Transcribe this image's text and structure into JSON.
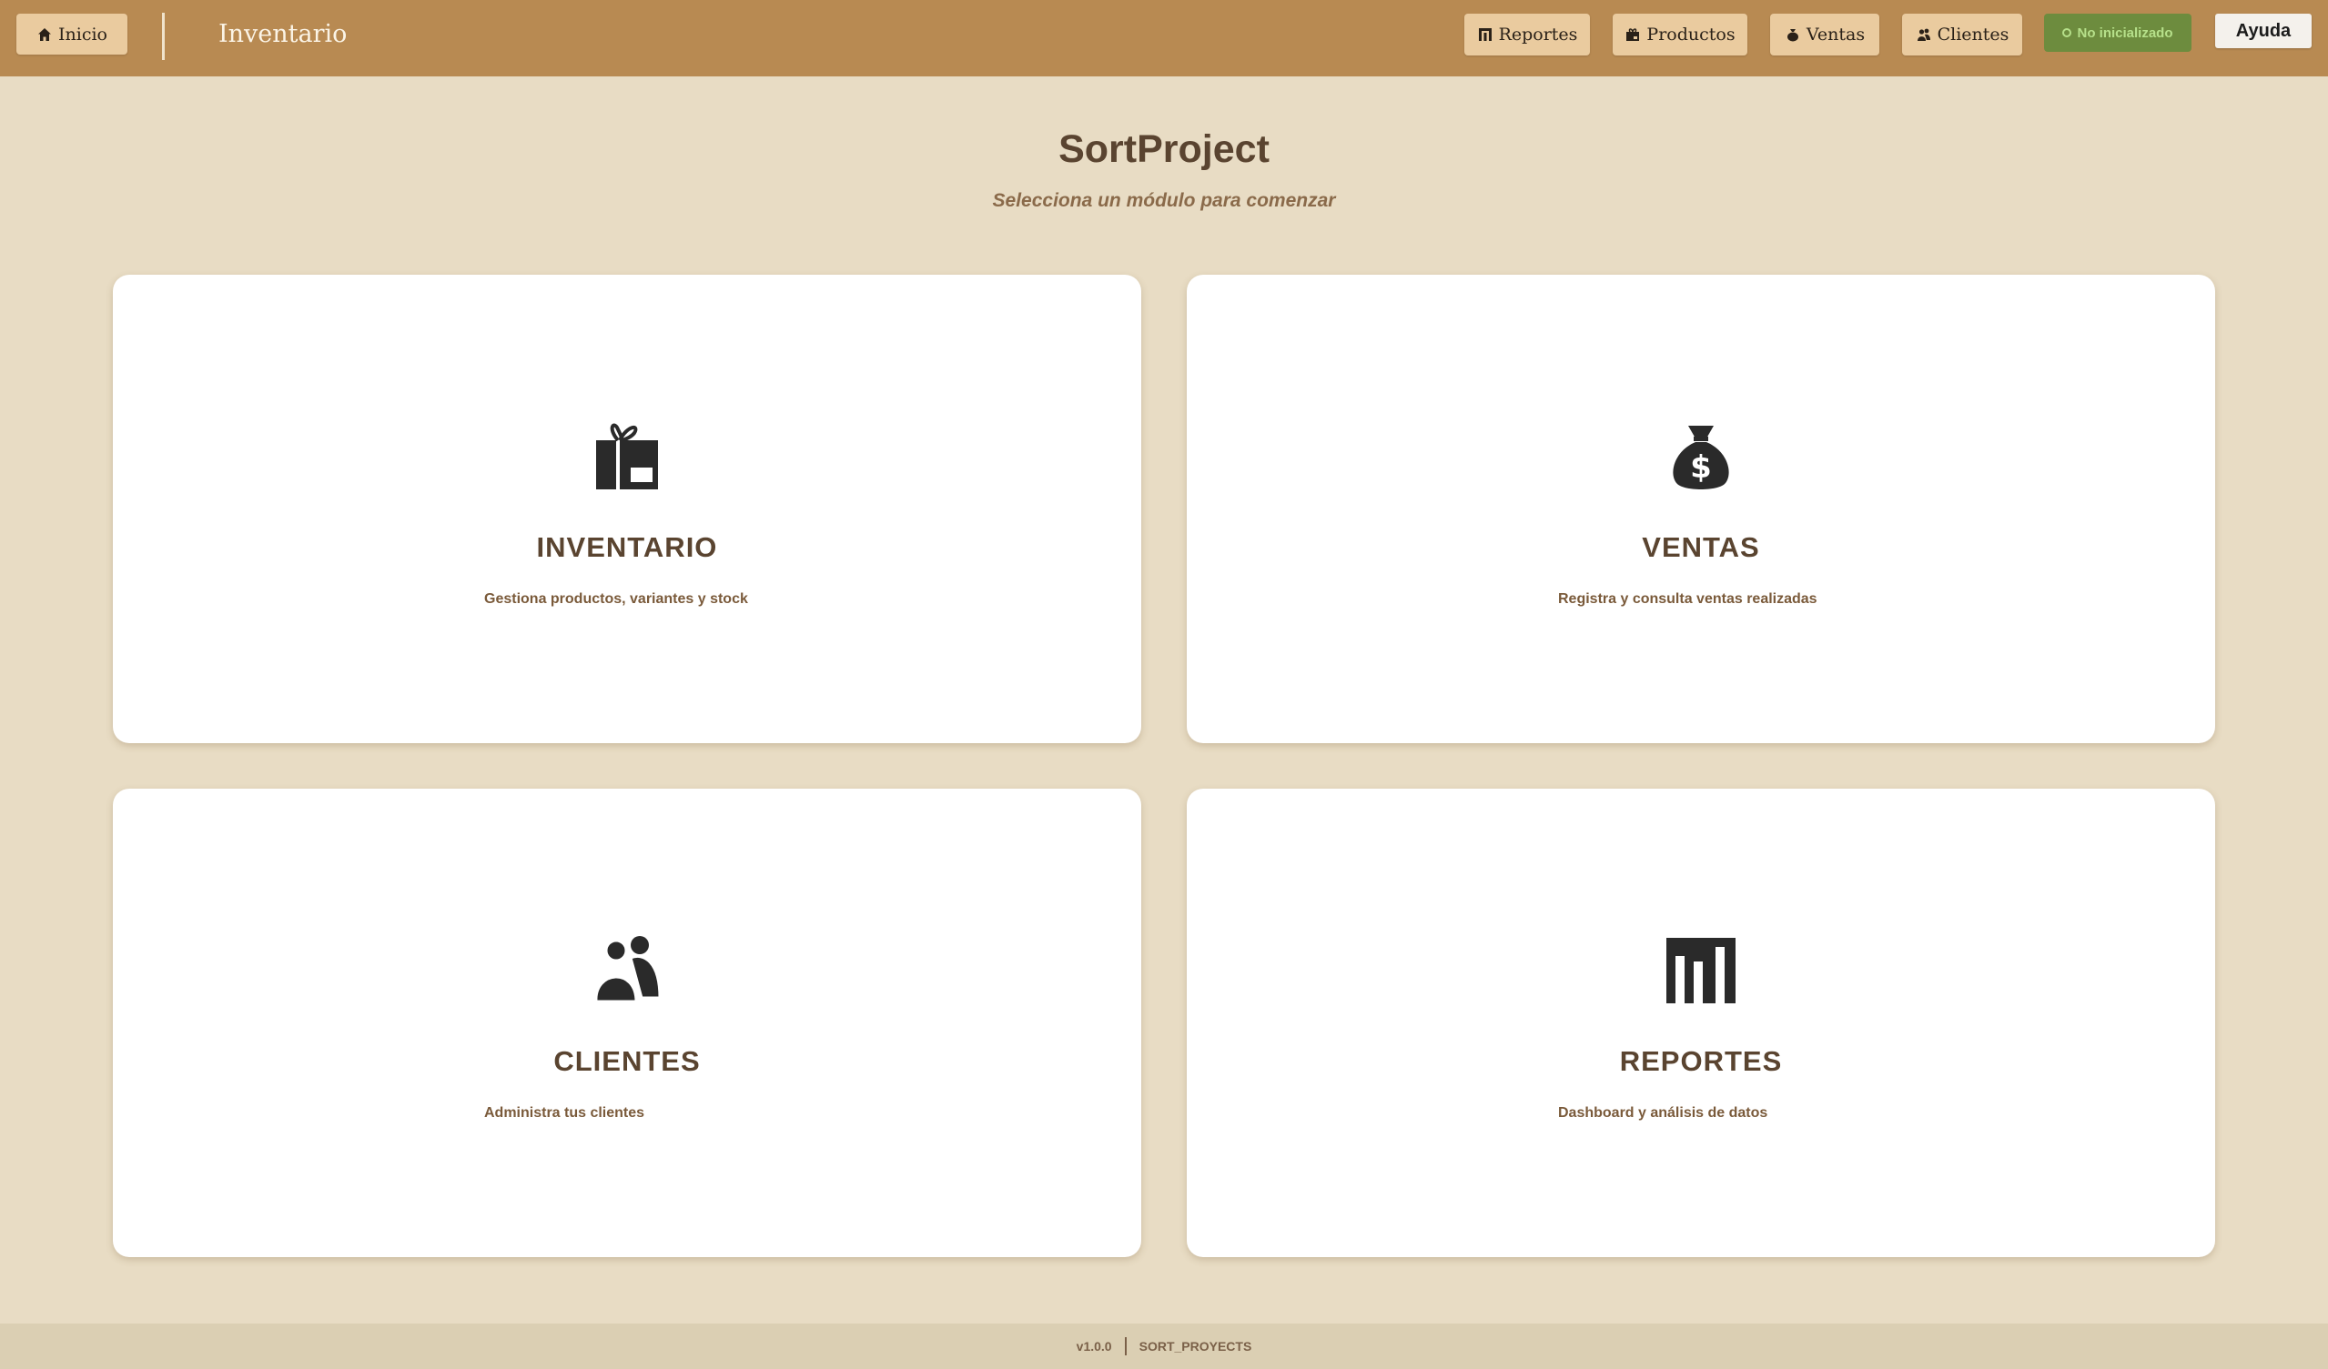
{
  "header": {
    "home_label": "Inicio",
    "breadcrumb": "Inventario",
    "nav": [
      {
        "label": "Reportes",
        "icon": "bar-chart-icon"
      },
      {
        "label": "Productos",
        "icon": "package-icon"
      },
      {
        "label": "Ventas",
        "icon": "money-bag-icon"
      },
      {
        "label": "Clientes",
        "icon": "people-icon"
      }
    ],
    "status_label": "No inicializado",
    "help_label": "Ayuda"
  },
  "main": {
    "title": "SortProject",
    "subtitle": "Selecciona un módulo para comenzar",
    "modules": [
      {
        "title": "INVENTARIO",
        "description": "Gestiona productos, variantes y stock",
        "icon": "gift-box-icon"
      },
      {
        "title": "VENTAS",
        "description": "Registra y consulta ventas realizadas",
        "icon": "money-bag-icon"
      },
      {
        "title": "CLIENTES",
        "description": "Administra tus clientes",
        "icon": "people-icon"
      },
      {
        "title": "REPORTES",
        "description": "Dashboard y análisis de datos",
        "icon": "bar-chart-icon"
      }
    ]
  },
  "footer": {
    "version": "v1.0.0",
    "brand": "SORT_PROYECTS"
  },
  "colors": {
    "header_bg": "#b88a52",
    "page_bg": "#e8dcc4",
    "button_bg": "#eacb9f",
    "status_bg": "#6d8c3e",
    "title_text": "#5a4430"
  }
}
